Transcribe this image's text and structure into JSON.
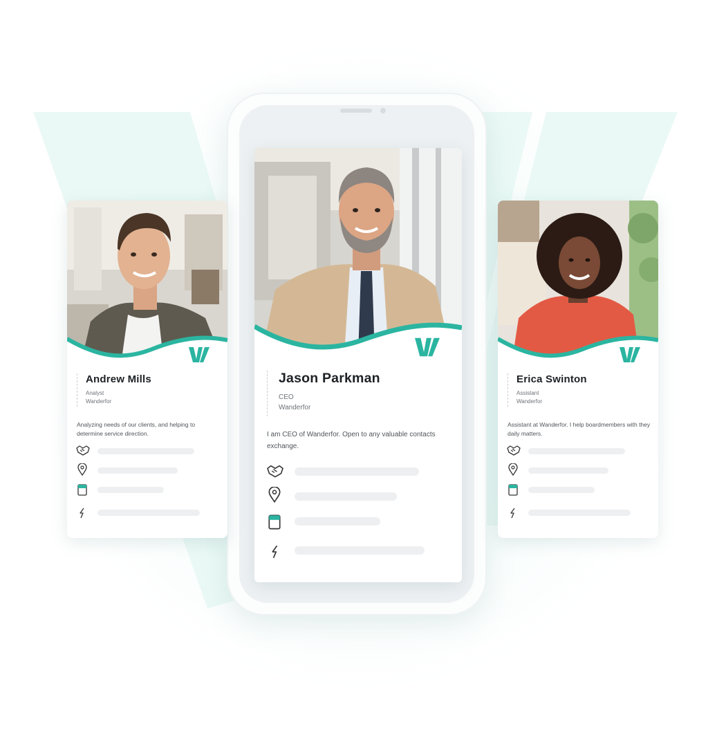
{
  "colors": {
    "accent_teal": "#2bb5a1",
    "teal_light": "#dff5f0",
    "card_bg": "#ffffff",
    "placeholder_bar": "#edeff1",
    "text_dark": "#1d2125"
  },
  "cards": [
    {
      "name": "Andrew Mills",
      "role": "Analyst",
      "company": "Wanderfor",
      "description": "Analyzing needs of our clients, and helping to determine service direction.",
      "icons": [
        "handshake-icon",
        "location-pin-icon",
        "calendar-icon",
        "lightning-icon"
      ]
    },
    {
      "name": "Jason Parkman",
      "role": "CEO",
      "company": "Wanderfor",
      "description": "I am CEO of Wanderfor. Open to any valuable contacts exchange.",
      "icons": [
        "handshake-icon",
        "location-pin-icon",
        "calendar-icon",
        "lightning-icon"
      ]
    },
    {
      "name": "Erica Swinton",
      "role": "Assistant",
      "company": "Wanderfor",
      "description": "Assistant at Wanderfor.  I help boardmembers with they daily matters.",
      "icons": [
        "handshake-icon",
        "location-pin-icon",
        "calendar-icon",
        "lightning-icon"
      ]
    }
  ]
}
